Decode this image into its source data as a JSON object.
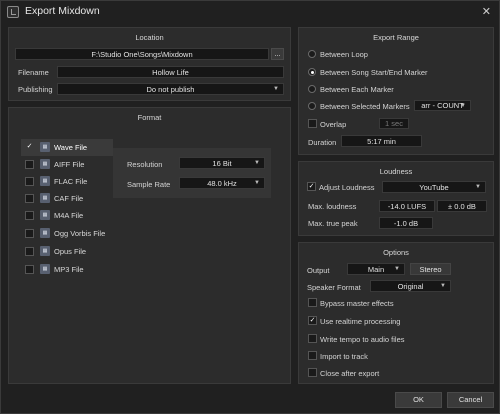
{
  "window": {
    "title": "Export Mixdown",
    "close": "✕"
  },
  "location": {
    "title": "Location",
    "path": "F:\\Studio One\\Songs\\Mixdown",
    "browse": "...",
    "filename_label": "Filename",
    "filename": "Hollow Life",
    "publishing_label": "Publishing",
    "publishing": "Do not publish"
  },
  "format": {
    "title": "Format",
    "items": [
      {
        "label": "Wave File",
        "checked": true
      },
      {
        "label": "AIFF File",
        "checked": false
      },
      {
        "label": "FLAC File",
        "checked": false
      },
      {
        "label": "CAF File",
        "checked": false
      },
      {
        "label": "M4A File",
        "checked": false
      },
      {
        "label": "Ogg Vorbis File",
        "checked": false
      },
      {
        "label": "Opus File",
        "checked": false
      },
      {
        "label": "MP3 File",
        "checked": false
      }
    ],
    "resolution_label": "Resolution",
    "resolution": "16 Bit",
    "sample_rate_label": "Sample Rate",
    "sample_rate": "48.0 kHz"
  },
  "export_range": {
    "title": "Export Range",
    "options": [
      {
        "label": "Between Loop",
        "selected": false
      },
      {
        "label": "Between Song Start/End Marker",
        "selected": true
      },
      {
        "label": "Between Each Marker",
        "selected": false
      },
      {
        "label": "Between Selected Markers",
        "selected": false
      }
    ],
    "marker_combo": "arr - COUNT",
    "overlap_label": "Overlap",
    "overlap_value": "1 sec",
    "duration_label": "Duration",
    "duration": "5:17 min"
  },
  "loudness": {
    "title": "Loudness",
    "adjust_label": "Adjust Loudness",
    "adjust_checked": true,
    "preset": "YouTube",
    "max_loudness_label": "Max. loudness",
    "max_loudness": "-14.0 LUFS",
    "max_loudness_offset": "± 0.0 dB",
    "max_peak_label": "Max. true peak",
    "max_peak": "-1.0 dB"
  },
  "options": {
    "title": "Options",
    "output_label": "Output",
    "output": "Main",
    "output_mode": "Stereo",
    "speaker_label": "Speaker Format",
    "speaker": "Original",
    "checks": [
      {
        "label": "Bypass master effects",
        "checked": false
      },
      {
        "label": "Use realtime processing",
        "checked": true
      },
      {
        "label": "Write tempo to audio files",
        "checked": false
      },
      {
        "label": "Import to track",
        "checked": false
      },
      {
        "label": "Close after export",
        "checked": false
      }
    ]
  },
  "footer": {
    "ok": "OK",
    "cancel": "Cancel"
  },
  "icons": {
    "check": "✓",
    "dropdown": "▼",
    "file": "▦"
  },
  "colors": {
    "background": "#202020",
    "panel": "#2c2c2c",
    "field": "#161616",
    "accent": "#ffffff"
  }
}
